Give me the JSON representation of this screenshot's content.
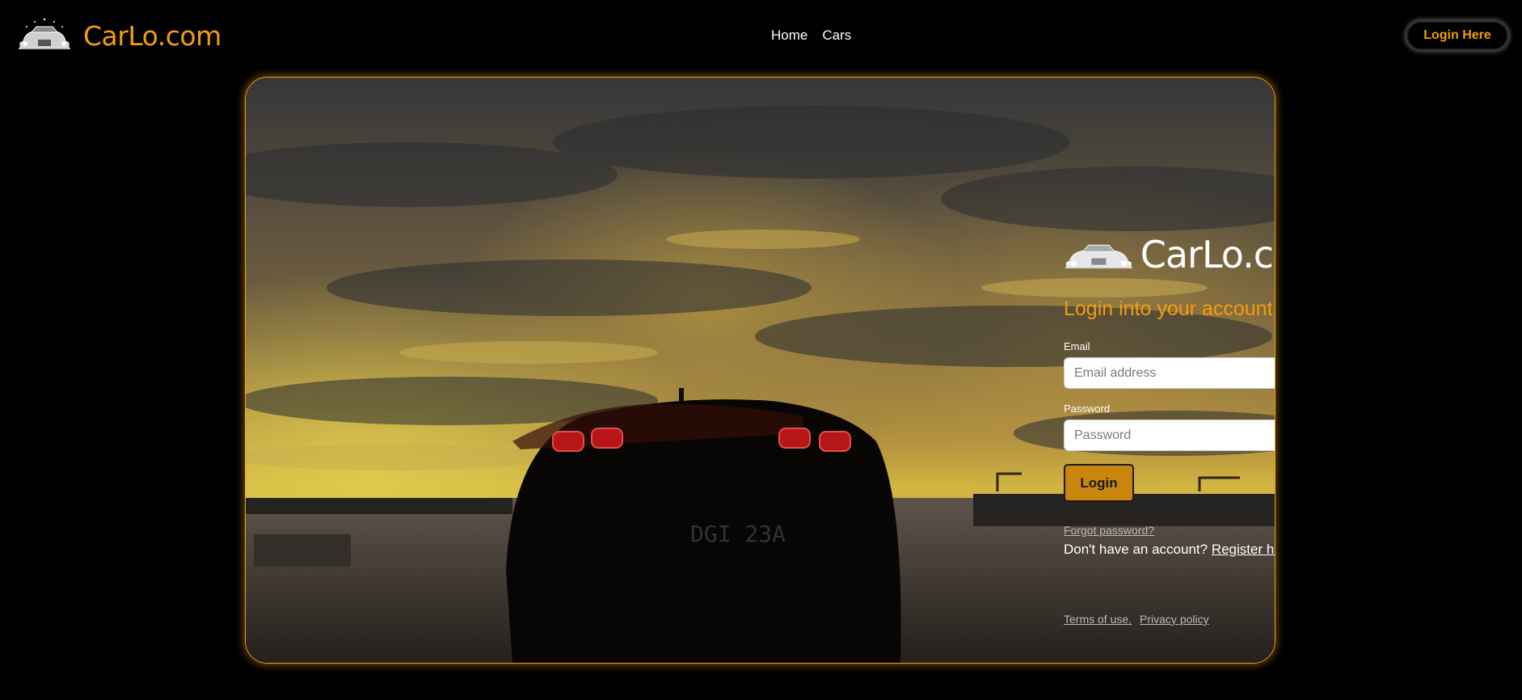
{
  "brand": {
    "name": "CarLo.com",
    "logo_icon": "car-logo-icon",
    "color": "#f39c12"
  },
  "nav": {
    "links": [
      {
        "label": "Home"
      },
      {
        "label": "Cars"
      }
    ]
  },
  "header": {
    "login_button_label": "Login Here"
  },
  "hero": {
    "background": "red-sports-car-rear-at-sunset-photo",
    "border_color": "#e8a11a",
    "plate_text": "DGI 23A"
  },
  "login": {
    "brand_name": "CarLo.com",
    "heading": "Login into your account",
    "email": {
      "label": "Email",
      "placeholder": "Email address",
      "value": ""
    },
    "password": {
      "label": "Password",
      "placeholder": "Password",
      "value": ""
    },
    "submit_label": "Login",
    "forgot_label": "Forgot password?",
    "register_prompt": "Don't have an account?",
    "register_link": "Register here",
    "terms_label": "Terms of use.",
    "privacy_label": "Privacy policy"
  },
  "colors": {
    "accent": "#f39c12",
    "button": "#c8860d",
    "background": "#000000"
  }
}
